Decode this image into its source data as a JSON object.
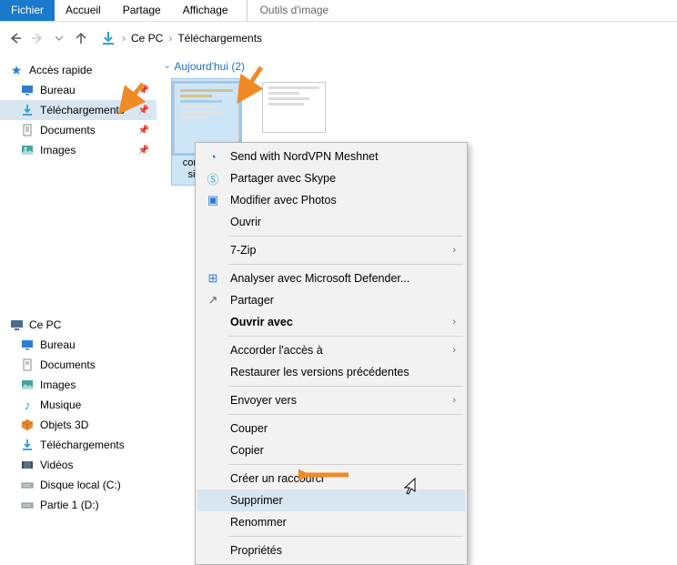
{
  "ribbon": {
    "tabs": [
      "Fichier",
      "Accueil",
      "Partage",
      "Affichage"
    ],
    "toolTab": "Outils d'image"
  },
  "breadcrumb": {
    "root": "Ce PC",
    "folder": "Téléchargements"
  },
  "sidebar": {
    "quickAccess": "Accès rapide",
    "quickItems": [
      {
        "label": "Bureau",
        "icon": "desktop",
        "pinned": true
      },
      {
        "label": "Téléchargements",
        "icon": "download",
        "pinned": true,
        "selected": true
      },
      {
        "label": "Documents",
        "icon": "document",
        "pinned": true
      },
      {
        "label": "Images",
        "icon": "images",
        "pinned": true
      }
    ],
    "thisPC": "Ce PC",
    "pcItems": [
      {
        "label": "Bureau",
        "icon": "desktop"
      },
      {
        "label": "Documents",
        "icon": "document"
      },
      {
        "label": "Images",
        "icon": "images"
      },
      {
        "label": "Musique",
        "icon": "music"
      },
      {
        "label": "Objets 3D",
        "icon": "cube"
      },
      {
        "label": "Téléchargements",
        "icon": "download"
      },
      {
        "label": "Vidéos",
        "icon": "video"
      },
      {
        "label": "Disque local (C:)",
        "icon": "drive"
      },
      {
        "label": "Partie 1 (D:)",
        "icon": "drive"
      }
    ]
  },
  "content": {
    "groupHeader": "Aujourd'hui (2)",
    "files": [
      {
        "label": "configurer-sistant...",
        "selected": true
      },
      {
        "label": ""
      }
    ]
  },
  "contextMenu": {
    "items": [
      {
        "label": "Send with NordVPN Meshnet",
        "icon": "meshnet"
      },
      {
        "label": "Partager avec Skype",
        "icon": "skype"
      },
      {
        "label": "Modifier avec Photos",
        "icon": "photos"
      },
      {
        "label": "Ouvrir"
      },
      {
        "sep": true
      },
      {
        "label": "7-Zip",
        "submenu": true
      },
      {
        "sep": true
      },
      {
        "label": "Analyser avec Microsoft Defender...",
        "icon": "defender"
      },
      {
        "label": "Partager",
        "icon": "share"
      },
      {
        "label": "Ouvrir avec",
        "bold": true,
        "submenu": true
      },
      {
        "sep": true
      },
      {
        "label": "Accorder l'accès à",
        "submenu": true
      },
      {
        "label": "Restaurer les versions précédentes"
      },
      {
        "sep": true
      },
      {
        "label": "Envoyer vers",
        "submenu": true
      },
      {
        "sep": true
      },
      {
        "label": "Couper"
      },
      {
        "label": "Copier"
      },
      {
        "sep": true
      },
      {
        "label": "Créer un raccourci"
      },
      {
        "label": "Supprimer",
        "hover": true
      },
      {
        "label": "Renommer"
      },
      {
        "sep": true
      },
      {
        "label": "Propriétés"
      }
    ]
  }
}
